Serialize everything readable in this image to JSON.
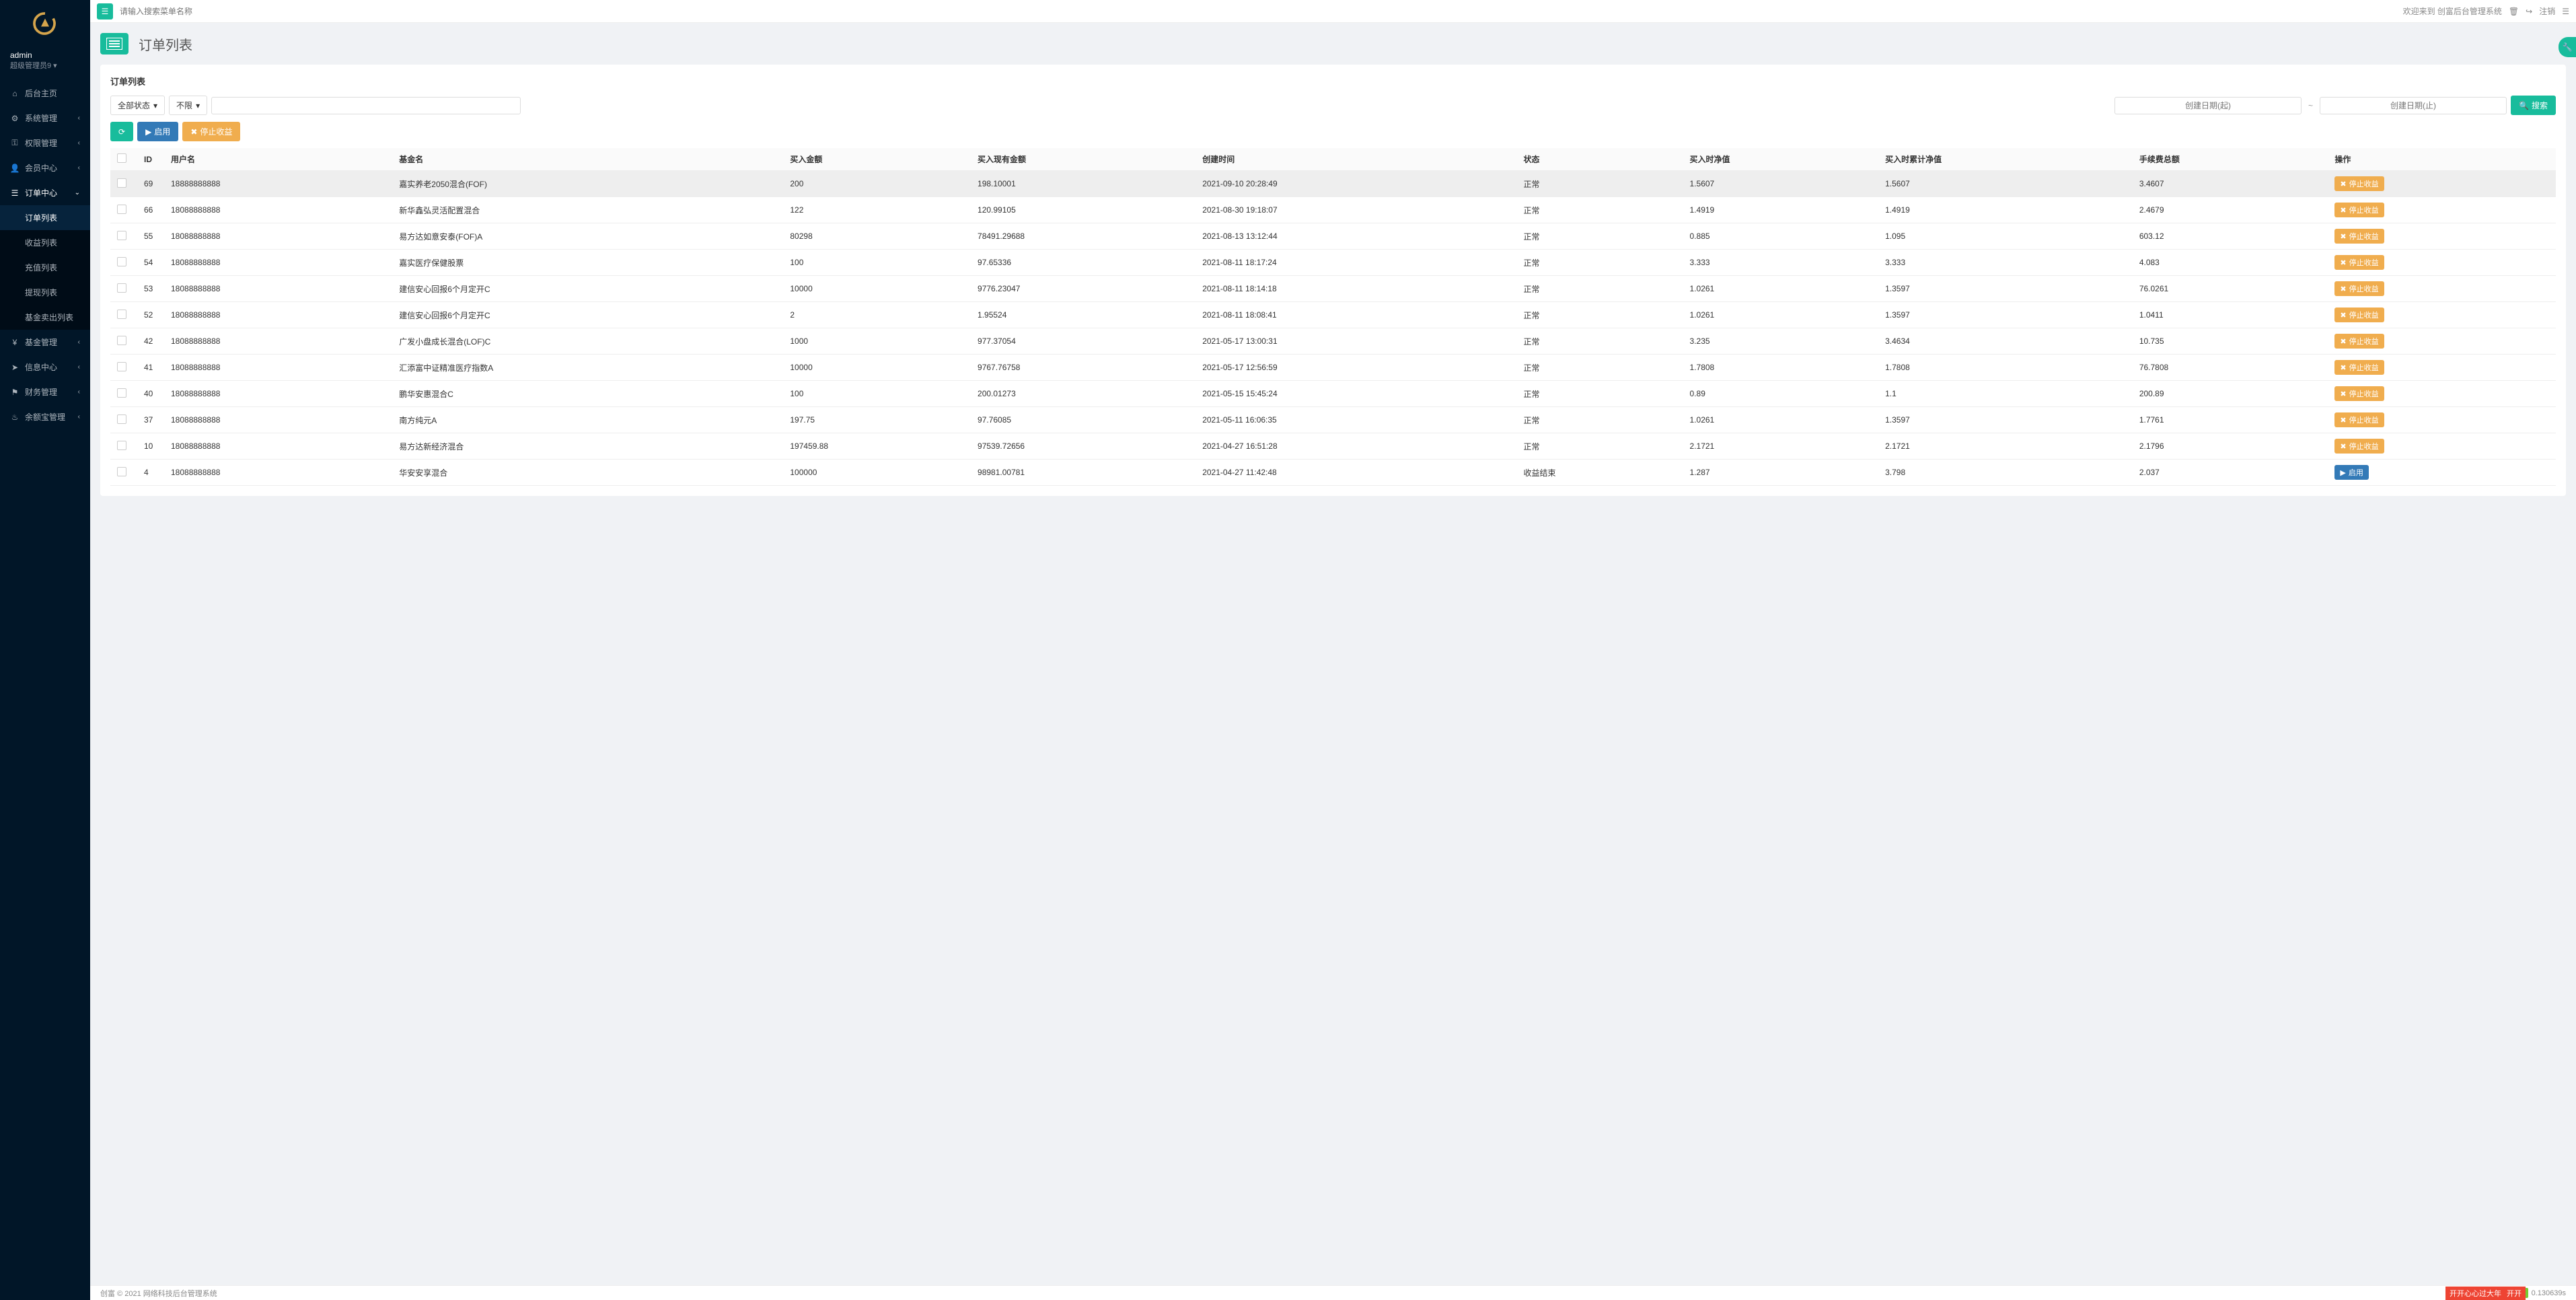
{
  "user": {
    "name": "admin",
    "role": "超级管理员9"
  },
  "topbar": {
    "search_placeholder": "请输入搜索菜单名称",
    "welcome": "欢迎来到 创富后台管理系统",
    "logout": "注销"
  },
  "sidebar": {
    "items": [
      {
        "label": "后台主页",
        "icon": "home"
      },
      {
        "label": "系统管理",
        "icon": "cogs",
        "expandable": true
      },
      {
        "label": "权限管理",
        "icon": "key",
        "expandable": true
      },
      {
        "label": "会员中心",
        "icon": "user",
        "expandable": true
      },
      {
        "label": "订单中心",
        "icon": "list",
        "expandable": true,
        "expanded": true,
        "children": [
          {
            "label": "订单列表",
            "active": true
          },
          {
            "label": "收益列表"
          },
          {
            "label": "充值列表"
          },
          {
            "label": "提现列表"
          },
          {
            "label": "基金卖出列表"
          }
        ]
      },
      {
        "label": "基金管理",
        "icon": "yen",
        "expandable": true
      },
      {
        "label": "信息中心",
        "icon": "share",
        "expandable": true
      },
      {
        "label": "财务管理",
        "icon": "flag",
        "expandable": true
      },
      {
        "label": "余额宝管理",
        "icon": "fire",
        "expandable": true
      }
    ]
  },
  "page": {
    "title": "订单列表",
    "card_title": "订单列表"
  },
  "filters": {
    "status_label": "全部状态",
    "limit_label": "不限",
    "date_start_placeholder": "创建日期(起)",
    "date_end_placeholder": "创建日期(止)",
    "search_label": "搜索"
  },
  "actions": {
    "enable": "启用",
    "stop_profit": "停止收益"
  },
  "table": {
    "columns": [
      "ID",
      "用户名",
      "基金名",
      "买入金额",
      "买入现有金额",
      "创建时间",
      "状态",
      "买入时净值",
      "买入时累计净值",
      "手续费总额",
      "操作"
    ],
    "rows": [
      {
        "id": "69",
        "user": "18888888888",
        "fund": "嘉实养老2050混合(FOF)",
        "buy": "200",
        "cur": "198.10001",
        "time": "2021-09-10 20:28:49",
        "status": "正常",
        "nav": "1.5607",
        "cum": "1.5607",
        "fee": "3.4607",
        "act": "停止收益",
        "btn": "warning",
        "hl": true
      },
      {
        "id": "66",
        "user": "18088888888",
        "fund": "新华鑫弘灵活配置混合",
        "buy": "122",
        "cur": "120.99105",
        "time": "2021-08-30 19:18:07",
        "status": "正常",
        "nav": "1.4919",
        "cum": "1.4919",
        "fee": "2.4679",
        "act": "停止收益",
        "btn": "warning"
      },
      {
        "id": "55",
        "user": "18088888888",
        "fund": "易方达如意安泰(FOF)A",
        "buy": "80298",
        "cur": "78491.29688",
        "time": "2021-08-13 13:12:44",
        "status": "正常",
        "nav": "0.885",
        "cum": "1.095",
        "fee": "603.12",
        "act": "停止收益",
        "btn": "warning"
      },
      {
        "id": "54",
        "user": "18088888888",
        "fund": "嘉实医疗保健股票",
        "buy": "100",
        "cur": "97.65336",
        "time": "2021-08-11 18:17:24",
        "status": "正常",
        "nav": "3.333",
        "cum": "3.333",
        "fee": "4.083",
        "act": "停止收益",
        "btn": "warning"
      },
      {
        "id": "53",
        "user": "18088888888",
        "fund": "建信安心回报6个月定开C",
        "buy": "10000",
        "cur": "9776.23047",
        "time": "2021-08-11 18:14:18",
        "status": "正常",
        "nav": "1.0261",
        "cum": "1.3597",
        "fee": "76.0261",
        "act": "停止收益",
        "btn": "warning"
      },
      {
        "id": "52",
        "user": "18088888888",
        "fund": "建信安心回报6个月定开C",
        "buy": "2",
        "cur": "1.95524",
        "time": "2021-08-11 18:08:41",
        "status": "正常",
        "nav": "1.0261",
        "cum": "1.3597",
        "fee": "1.0411",
        "act": "停止收益",
        "btn": "warning"
      },
      {
        "id": "42",
        "user": "18088888888",
        "fund": "广发小盘成长混合(LOF)C",
        "buy": "1000",
        "cur": "977.37054",
        "time": "2021-05-17 13:00:31",
        "status": "正常",
        "nav": "3.235",
        "cum": "3.4634",
        "fee": "10.735",
        "act": "停止收益",
        "btn": "warning"
      },
      {
        "id": "41",
        "user": "18088888888",
        "fund": "汇添富中证精准医疗指数A",
        "buy": "10000",
        "cur": "9767.76758",
        "time": "2021-05-17 12:56:59",
        "status": "正常",
        "nav": "1.7808",
        "cum": "1.7808",
        "fee": "76.7808",
        "act": "停止收益",
        "btn": "warning"
      },
      {
        "id": "40",
        "user": "18088888888",
        "fund": "鹏华安惠混合C",
        "buy": "100",
        "cur": "200.01273",
        "time": "2021-05-15 15:45:24",
        "status": "正常",
        "nav": "0.89",
        "cum": "1.1",
        "fee": "200.89",
        "act": "停止收益",
        "btn": "warning"
      },
      {
        "id": "37",
        "user": "18088888888",
        "fund": "南方纯元A",
        "buy": "197.75",
        "cur": "97.76085",
        "time": "2021-05-11 16:06:35",
        "status": "正常",
        "nav": "1.0261",
        "cum": "1.3597",
        "fee": "1.7761",
        "act": "停止收益",
        "btn": "warning"
      },
      {
        "id": "10",
        "user": "18088888888",
        "fund": "易方达新经济混合",
        "buy": "197459.88",
        "cur": "97539.72656",
        "time": "2021-04-27 16:51:28",
        "status": "正常",
        "nav": "2.1721",
        "cum": "2.1721",
        "fee": "2.1796",
        "act": "停止收益",
        "btn": "warning"
      },
      {
        "id": "4",
        "user": "18088888888",
        "fund": "华安安享混合",
        "buy": "100000",
        "cur": "98981.00781",
        "time": "2021-04-27 11:42:48",
        "status": "收益结束",
        "nav": "1.287",
        "cum": "3.798",
        "fee": "2.037",
        "act": "启用",
        "btn": "primary"
      }
    ]
  },
  "footer": {
    "copyright": "创富 © 2021 网络科技后台管理系统",
    "metric": "0.130639s"
  },
  "overlay": {
    "t1": "开开心心过大年",
    "t2": "开开"
  }
}
